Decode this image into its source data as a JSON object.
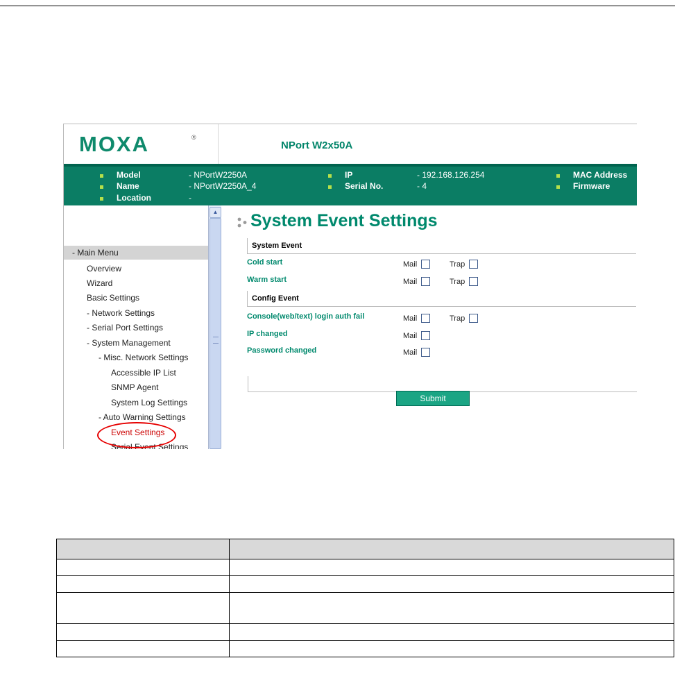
{
  "logo": {
    "text": "MOXA",
    "registered": "®"
  },
  "header": {
    "product": "NPort W2x50A"
  },
  "info": {
    "model_label": "Model",
    "model_value": "- NPortW2250A",
    "name_label": "Name",
    "name_value": "- NPortW2250A_4",
    "location_label": "Location",
    "location_value": "-",
    "ip_label": "IP",
    "ip_value": "- 192.168.126.254",
    "serial_label": "Serial No.",
    "serial_value": "- 4",
    "mac_label": "MAC Address",
    "firmware_label": "Firmware"
  },
  "menu": {
    "header": "- Main Menu",
    "items": [
      {
        "label": "Overview"
      },
      {
        "label": "Wizard"
      },
      {
        "label": "Basic Settings"
      },
      {
        "label": "- Network Settings"
      },
      {
        "label": "- Serial Port Settings"
      },
      {
        "label": "- System Management"
      },
      {
        "label": "- Misc. Network Settings"
      },
      {
        "label": "Accessible IP List"
      },
      {
        "label": "SNMP Agent"
      },
      {
        "label": "System Log Settings"
      },
      {
        "label": "- Auto Warning Settings"
      },
      {
        "label": "Event Settings"
      },
      {
        "label": "Serial Event Settings"
      }
    ]
  },
  "content": {
    "title": "System Event Settings",
    "system_event_header": "System Event",
    "config_event_header": "Config Event",
    "rows": [
      {
        "label": "Cold start",
        "mail": "Mail",
        "trap": "Trap"
      },
      {
        "label": "Warm start",
        "mail": "Mail",
        "trap": "Trap"
      },
      {
        "label": "Console(web/text) login auth fail",
        "mail": "Mail",
        "trap": "Trap"
      },
      {
        "label": "IP changed",
        "mail": "Mail"
      },
      {
        "label": "Password changed",
        "mail": "Mail"
      }
    ],
    "submit_label": "Submit"
  },
  "colors": {
    "brand_green": "#0b7d64",
    "title_green": "#00896d",
    "highlight_red": "#e60000"
  }
}
